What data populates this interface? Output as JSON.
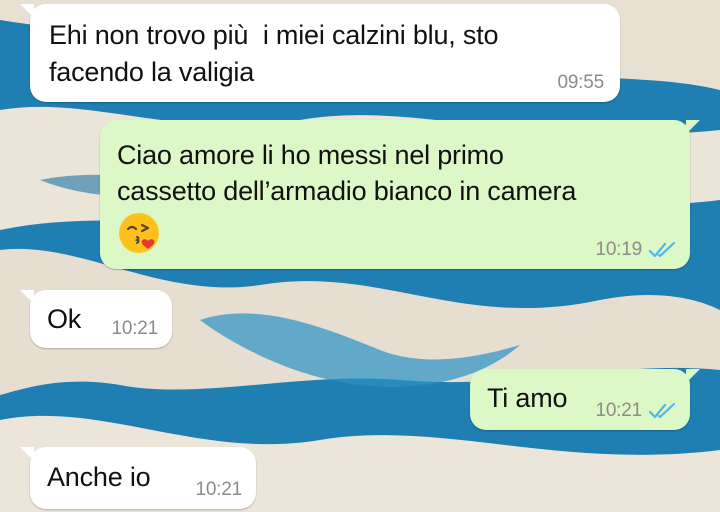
{
  "colors": {
    "incoming_bubble": "#ffffff",
    "outgoing_bubble": "#dcf8c6",
    "timestamp": "#8c8c8c",
    "read_ticks": "#4fb6ec",
    "wallpaper_water": "#1f7fb3",
    "wallpaper_sand": "#e9e2d6"
  },
  "messages": [
    {
      "direction": "incoming",
      "lines": [
        "Ehi non trovo più  i miei calzini blu, sto",
        "facendo la valigia"
      ],
      "time": "09:55"
    },
    {
      "direction": "outgoing",
      "lines": [
        "Ciao amore li ho messi nel primo",
        "cassetto dell’armadio bianco in camera"
      ],
      "emoji": "face-blowing-a-kiss",
      "time": "10:19",
      "status_icon": "double-check-read-icon"
    },
    {
      "direction": "incoming",
      "lines": [
        "Ok"
      ],
      "time": "10:21"
    },
    {
      "direction": "outgoing",
      "lines": [
        "Ti amo"
      ],
      "time": "10:21",
      "status_icon": "double-check-read-icon"
    },
    {
      "direction": "incoming",
      "lines": [
        "Anche io"
      ],
      "time": "10:21"
    }
  ]
}
